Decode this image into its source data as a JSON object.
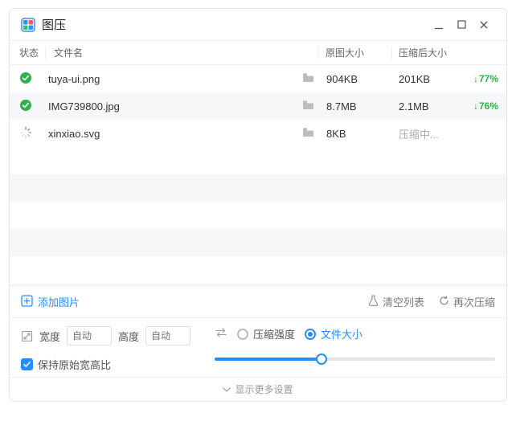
{
  "window": {
    "title": "图压"
  },
  "columns": {
    "status": "状态",
    "name": "文件名",
    "original": "原图大小",
    "compressed": "压缩后大小"
  },
  "rows": [
    {
      "status": "done",
      "name": "tuya-ui.png",
      "orig": "904KB",
      "comp": "201KB",
      "pct": "77%"
    },
    {
      "status": "done",
      "name": "IMG739800.jpg",
      "orig": "8.7MB",
      "comp": "2.1MB",
      "pct": "76%"
    },
    {
      "status": "busy",
      "name": "xinxiao.svg",
      "orig": "8KB",
      "comp": "压缩中...",
      "pct": ""
    }
  ],
  "actions": {
    "add": "添加图片",
    "clear": "清空列表",
    "recompress": "再次压缩"
  },
  "settings": {
    "width_label": "宽度",
    "width_placeholder": "自动",
    "height_label": "高度",
    "height_placeholder": "自动",
    "keep_aspect": "保持原始宽高比",
    "mode_strength": "压缩强度",
    "mode_filesize": "文件大小",
    "show_more": "显示更多设置"
  }
}
